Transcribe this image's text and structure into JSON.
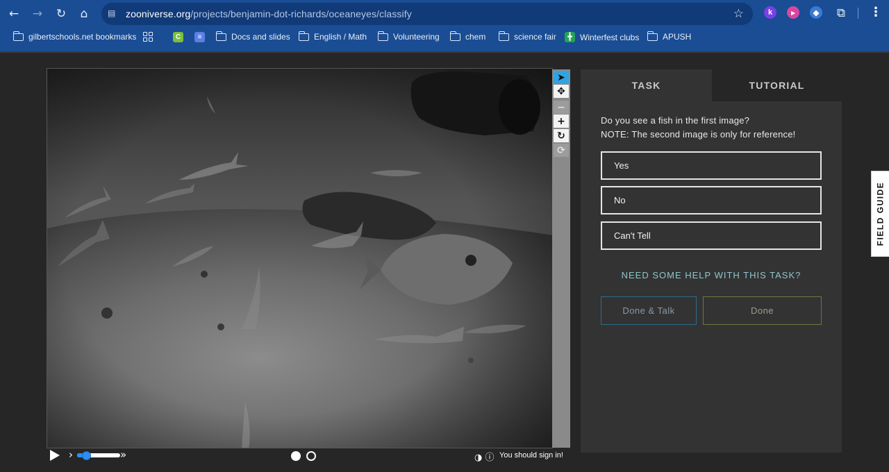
{
  "browser": {
    "url_host": "zooniverse.org",
    "url_path": "/projects/benjamin-dot-richards/oceaneyes/classify",
    "bookmarks": [
      {
        "label": "gilbertschools.net bookmarks",
        "icon": "managed-folder-icon"
      },
      {
        "label": "",
        "icon": "apps-grid-icon"
      },
      {
        "label": "",
        "icon": "c-app-icon"
      },
      {
        "label": "",
        "icon": "striped-app-icon"
      },
      {
        "label": "Docs and slides",
        "icon": "folder-icon"
      },
      {
        "label": "English / Math",
        "icon": "folder-icon"
      },
      {
        "label": "Volunteering",
        "icon": "folder-icon"
      },
      {
        "label": "chem",
        "icon": "folder-icon"
      },
      {
        "label": "science fair",
        "icon": "folder-icon"
      },
      {
        "label": "Winterfest clubs",
        "icon": "sheets-icon"
      },
      {
        "label": "APUSH",
        "icon": "folder-icon"
      }
    ],
    "extensions": [
      {
        "letter": "k",
        "color": "#7b3fe4"
      },
      {
        "letter": "",
        "color": "#d9469f"
      },
      {
        "letter": "",
        "color": "#3a7bd5"
      }
    ]
  },
  "viewer": {
    "tools": [
      "pointer",
      "move",
      "zoom-out",
      "zoom-in",
      "rotate",
      "reset"
    ],
    "frames": 2,
    "current_frame": 1,
    "signin_text": "You should sign in!"
  },
  "task_panel": {
    "tabs": [
      "TASK",
      "TUTORIAL"
    ],
    "active_tab": "TASK",
    "question_line1": "Do you see a fish in the first image?",
    "question_line2": "NOTE: The second image is only for reference!",
    "answers": [
      "Yes",
      "No",
      "Can't Tell"
    ],
    "help_link": "NEED SOME HELP WITH THIS TASK?",
    "done_talk_label": "Done & Talk",
    "done_label": "Done"
  },
  "field_guide": {
    "label": "FIELD GUIDE"
  },
  "colors": {
    "chrome_blue": "#1a4d94",
    "page_bg": "#262626",
    "panel_bg": "#333333",
    "help_teal": "#8fc6cc",
    "tool_active": "#32a3e2"
  }
}
